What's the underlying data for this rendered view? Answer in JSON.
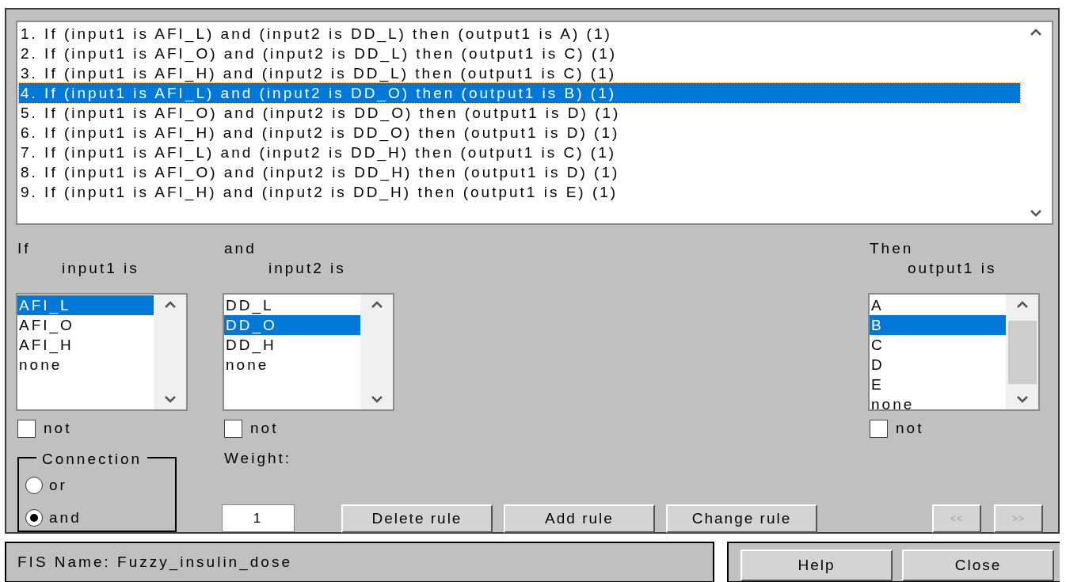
{
  "rules": [
    {
      "text": "1. If (input1 is AFI_L) and (input2 is DD_L) then (output1 is A) (1)",
      "selected": false
    },
    {
      "text": "2. If (input1 is AFI_O) and (input2 is DD_L) then (output1 is C) (1)",
      "selected": false
    },
    {
      "text": "3. If (input1 is AFI_H) and (input2 is DD_L) then (output1 is C) (1)",
      "selected": false
    },
    {
      "text": "4. If (input1 is AFI_L) and (input2 is DD_O) then (output1 is B) (1)",
      "selected": true
    },
    {
      "text": "5. If (input1 is AFI_O) and (input2 is DD_O) then (output1 is D) (1)",
      "selected": false
    },
    {
      "text": "6. If (input1 is AFI_H) and (input2 is DD_O) then (output1 is D) (1)",
      "selected": false
    },
    {
      "text": "7. If (input1 is AFI_L) and (input2 is DD_H) then (output1 is C) (1)",
      "selected": false
    },
    {
      "text": "8. If (input1 is AFI_O) and (input2 is DD_H) then (output1 is D) (1)",
      "selected": false
    },
    {
      "text": "9. If (input1 is AFI_H) and (input2 is DD_H) then (output1 is E) (1)",
      "selected": false
    }
  ],
  "variables": [
    {
      "kind": "input",
      "label": "If",
      "heading": "input1 is",
      "not_label": "not",
      "not_checked": false,
      "items": [
        {
          "text": "AFI_L",
          "selected": true
        },
        {
          "text": "AFI_O",
          "selected": false
        },
        {
          "text": "AFI_H",
          "selected": false
        },
        {
          "text": "none",
          "selected": false
        }
      ]
    },
    {
      "kind": "input",
      "label": "and",
      "heading": "input2 is",
      "not_label": "not",
      "not_checked": false,
      "items": [
        {
          "text": "DD_L",
          "selected": false
        },
        {
          "text": "DD_O",
          "selected": true
        },
        {
          "text": "DD_H",
          "selected": false
        },
        {
          "text": "none",
          "selected": false
        }
      ]
    },
    {
      "kind": "output",
      "label": "Then",
      "heading": "output1 is",
      "not_label": "not",
      "not_checked": false,
      "items": [
        {
          "text": "A",
          "selected": false
        },
        {
          "text": "B",
          "selected": true
        },
        {
          "text": "C",
          "selected": false
        },
        {
          "text": "D",
          "selected": false
        },
        {
          "text": "E",
          "selected": false
        },
        {
          "text": "none",
          "selected": false
        }
      ]
    }
  ],
  "connection": {
    "title": "Connection",
    "options": [
      {
        "label": "or",
        "selected": false
      },
      {
        "label": "and",
        "selected": true
      }
    ]
  },
  "weight": {
    "label": "Weight:",
    "value": "1"
  },
  "buttons": [
    {
      "label": "Delete rule",
      "disabled": false
    },
    {
      "label": "Add rule",
      "disabled": false
    },
    {
      "label": "Change rule",
      "disabled": false
    }
  ],
  "nav_buttons": [
    {
      "label": "<<",
      "disabled": true
    },
    {
      "label": ">>",
      "disabled": true
    }
  ],
  "status": "FIS Name: Fuzzy_insulin_dose",
  "footer_buttons": [
    {
      "label": "Help",
      "disabled": false
    },
    {
      "label": "Close",
      "disabled": false
    }
  ]
}
